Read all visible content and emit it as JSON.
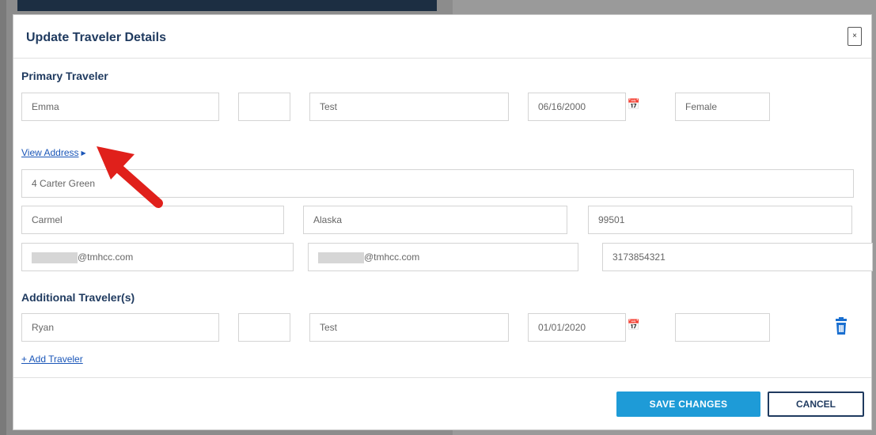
{
  "modal": {
    "title": "Update Traveler Details",
    "close_label": "×"
  },
  "primary": {
    "heading": "Primary Traveler",
    "first_name": "Emma",
    "middle_initial": "",
    "last_name": "Test",
    "dob": "06/16/2000",
    "gender": "Female"
  },
  "address": {
    "toggle_label": "View Address",
    "street": "4 Carter Green",
    "city": "Carmel",
    "state": "Alaska",
    "zip": "99501",
    "email1_suffix": "@tmhcc.com",
    "email2_suffix": "@tmhcc.com",
    "phone": "3173854321"
  },
  "additional": {
    "heading": "Additional Traveler(s)",
    "travelers": [
      {
        "first_name": "Ryan",
        "middle_initial": "",
        "last_name": "Test",
        "dob": "01/01/2020",
        "gender": ""
      }
    ],
    "add_label": "+ Add Traveler"
  },
  "footer": {
    "save_label": "SAVE CHANGES",
    "cancel_label": "CANCEL"
  },
  "icons": {
    "calendar": "calendar-icon",
    "trash": "trash-icon",
    "annotation_arrow": "red-arrow-annotation"
  },
  "colors": {
    "accent": "#1e9bd7",
    "heading": "#1f3a5f",
    "link": "#1a56b8",
    "trash": "#1a6fd0",
    "annotation": "#e0201b"
  }
}
